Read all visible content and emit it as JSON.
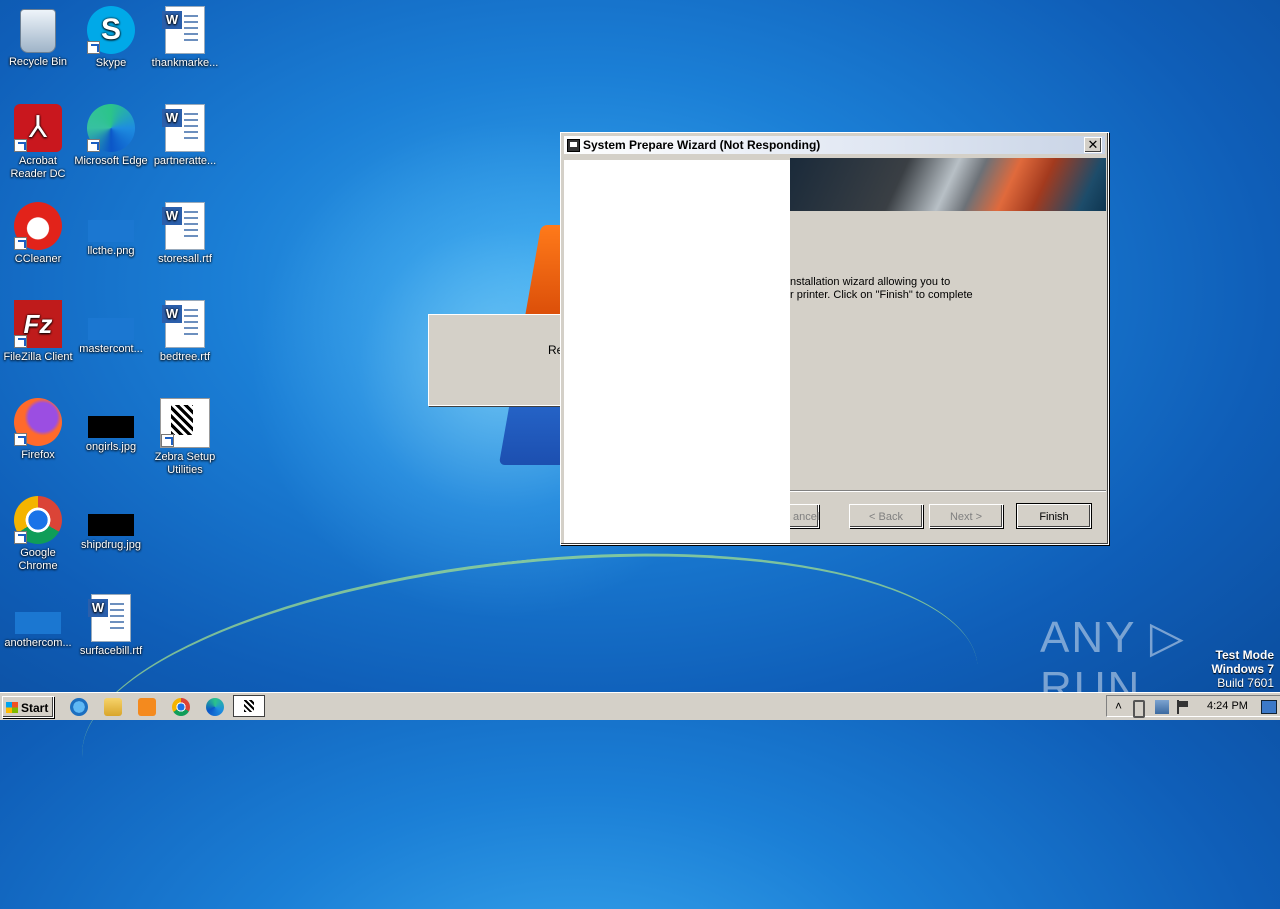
{
  "desktop": {
    "icons": [
      {
        "label": "Recycle Bin",
        "icon": "recycle-bin-icon"
      },
      {
        "label": "Skype",
        "icon": "skype-icon"
      },
      {
        "label": "thankmarke...",
        "icon": "word-doc-icon"
      },
      {
        "label": "Acrobat Reader DC",
        "icon": "acrobat-icon"
      },
      {
        "label": "Microsoft Edge",
        "icon": "edge-icon"
      },
      {
        "label": "partneratte...",
        "icon": "word-doc-icon"
      },
      {
        "label": "CCleaner",
        "icon": "ccleaner-icon"
      },
      {
        "label": "llcthe.png",
        "icon": "image-file-icon"
      },
      {
        "label": "storesall.rtf",
        "icon": "word-doc-icon"
      },
      {
        "label": "FileZilla Client",
        "icon": "filezilla-icon"
      },
      {
        "label": "mastercont...",
        "icon": "image-file-icon"
      },
      {
        "label": "bedtree.rtf",
        "icon": "word-doc-icon"
      },
      {
        "label": "Firefox",
        "icon": "firefox-icon"
      },
      {
        "label": "ongirls.jpg",
        "icon": "image-file-icon"
      },
      {
        "label": "Zebra Setup Utilities",
        "icon": "zebra-setup-icon"
      },
      {
        "label": "Google Chrome",
        "icon": "chrome-icon"
      },
      {
        "label": "shipdrug.jpg",
        "icon": "image-file-icon"
      },
      {
        "label": "anothercom...",
        "icon": "image-file-icon"
      },
      {
        "label": "surfacebill.rtf",
        "icon": "word-doc-icon"
      }
    ]
  },
  "background_dialog": {
    "partial_text": "Re"
  },
  "wizard": {
    "title": "System Prepare Wizard (Not Responding)",
    "close_label": "✕",
    "body_line1": "nstallation wizard allowing you to",
    "body_line2": "r printer. Click on \"Finish\" to complete",
    "buttons": {
      "cancel": "ancel",
      "back": "< Back",
      "next": "Next >",
      "finish": "Finish"
    }
  },
  "watermark": {
    "text": "ANY ▷ RUN"
  },
  "system_info": {
    "line1": "Test Mode",
    "line2": "Windows 7",
    "line3": "Build 7601"
  },
  "taskbar": {
    "start_label": "Start",
    "tray_arrow": "˄",
    "clock": "4:24 PM"
  }
}
